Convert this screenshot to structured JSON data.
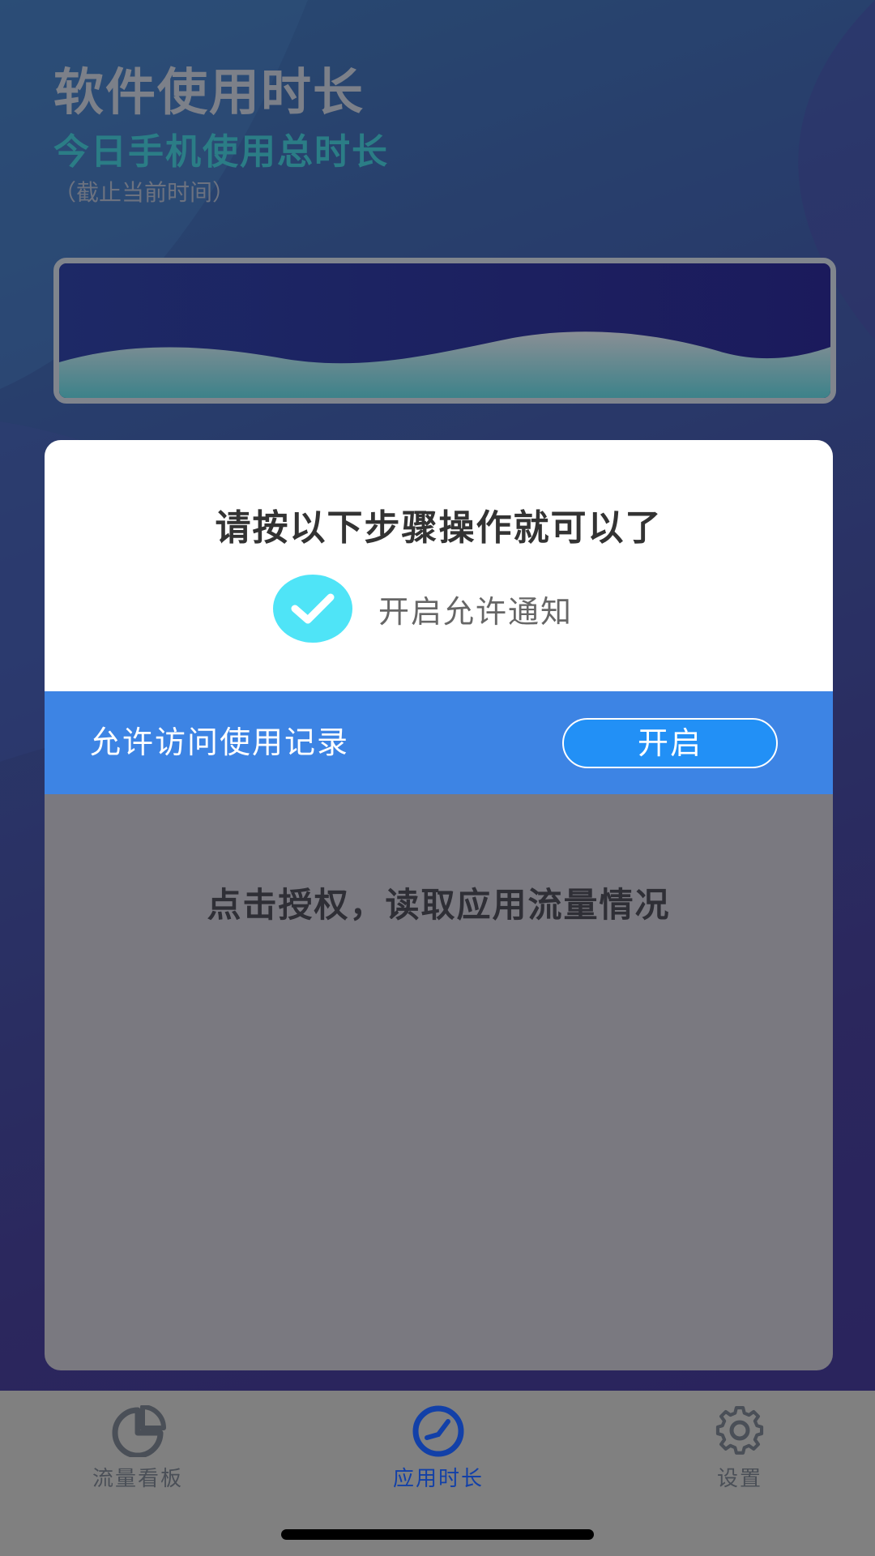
{
  "header": {
    "title": "软件使用时长",
    "subtitle": "今日手机使用总时长",
    "note": "（截止当前时间）"
  },
  "dialog": {
    "heading": "请按以下步骤操作就可以了",
    "step_label": "开启允许通知",
    "step_icon": "check-icon",
    "permission_label": "允许访问使用记录",
    "enable_button": "开启"
  },
  "panel": {
    "auth_text": "点击授权，读取应用流量情况"
  },
  "tabbar": {
    "items": [
      {
        "label": "流量看板",
        "icon": "pie-chart-icon"
      },
      {
        "label": "应用时长",
        "icon": "clock-icon"
      },
      {
        "label": "设置",
        "icon": "gear-icon"
      }
    ],
    "active_index": 1
  },
  "colors": {
    "accent": "#3d84e4",
    "button": "#2290f6",
    "check": "#4fe4f7",
    "active_tab": "#1240a8",
    "subtitle": "#2b7d86"
  }
}
